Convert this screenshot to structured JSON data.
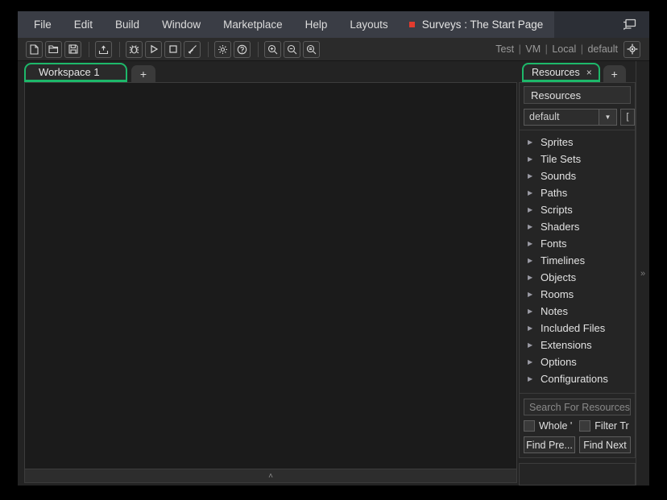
{
  "menubar": {
    "items": [
      {
        "label": "File"
      },
      {
        "label": "Edit"
      },
      {
        "label": "Build"
      },
      {
        "label": "Window"
      },
      {
        "label": "Marketplace"
      },
      {
        "label": "Help"
      },
      {
        "label": "Layouts"
      }
    ]
  },
  "titlebar": {
    "tab_title": "Surveys : The Start Page",
    "dirty_color": "#e23b2e",
    "chat_icon": "speech-bubble-icon"
  },
  "toolbar": {
    "buttons": [
      {
        "name": "new-file-button",
        "icon": "new-file-icon"
      },
      {
        "name": "open-project-button",
        "icon": "open-folder-icon"
      },
      {
        "name": "save-project-button",
        "icon": "save-disk-icon"
      },
      {
        "name": "export-project-button",
        "icon": "export-upload-icon"
      },
      {
        "name": "debug-button",
        "icon": "bug-icon"
      },
      {
        "name": "run-button",
        "icon": "play-triangle-icon"
      },
      {
        "name": "stop-button",
        "icon": "stop-square-icon"
      },
      {
        "name": "clean-button",
        "icon": "broom-icon"
      },
      {
        "name": "preferences-button",
        "icon": "gear-icon"
      },
      {
        "name": "help-button",
        "icon": "question-circle-icon"
      },
      {
        "name": "zoom-in-button",
        "icon": "magnifier-plus-icon"
      },
      {
        "name": "zoom-out-button",
        "icon": "magnifier-minus-icon"
      },
      {
        "name": "zoom-reset-button",
        "icon": "magnifier-equals-icon"
      }
    ],
    "status": {
      "target": "Test",
      "runtime": "VM",
      "device": "Local",
      "config": "default",
      "separator": "|"
    },
    "target_icon": "crosshair-target-icon"
  },
  "workspace": {
    "tabs": [
      {
        "label": "Workspace 1",
        "active": true
      }
    ],
    "add_tab_label": "+",
    "accent_color": "#1db86a",
    "canvas_color": "#1b1b1b",
    "footer_chevron": "˄"
  },
  "resources": {
    "tabs": [
      {
        "label": "Resources",
        "close_label": "×",
        "active": true
      }
    ],
    "add_tab_label": "+",
    "header": "Resources",
    "config_combo": {
      "value": "default",
      "arrow": "▼"
    },
    "side_button_label": "[",
    "tree": [
      {
        "label": "Sprites",
        "expanded": false
      },
      {
        "label": "Tile Sets",
        "expanded": false
      },
      {
        "label": "Sounds",
        "expanded": false
      },
      {
        "label": "Paths",
        "expanded": false
      },
      {
        "label": "Scripts",
        "expanded": false
      },
      {
        "label": "Shaders",
        "expanded": false
      },
      {
        "label": "Fonts",
        "expanded": false
      },
      {
        "label": "Timelines",
        "expanded": false
      },
      {
        "label": "Objects",
        "expanded": false
      },
      {
        "label": "Rooms",
        "expanded": false
      },
      {
        "label": "Notes",
        "expanded": false
      },
      {
        "label": "Included Files",
        "expanded": false
      },
      {
        "label": "Extensions",
        "expanded": false
      },
      {
        "label": "Options",
        "expanded": false
      },
      {
        "label": "Configurations",
        "expanded": false
      }
    ],
    "tree_arrow": "▶",
    "search_placeholder": "Search For Resources..",
    "search_value": "",
    "whole_word_label": "Whole '",
    "filter_tree_label": "Filter Tr",
    "find_prev_label": "Find Pre...",
    "find_next_label": "Find Next"
  },
  "collapse_rail": {
    "label": "»"
  }
}
